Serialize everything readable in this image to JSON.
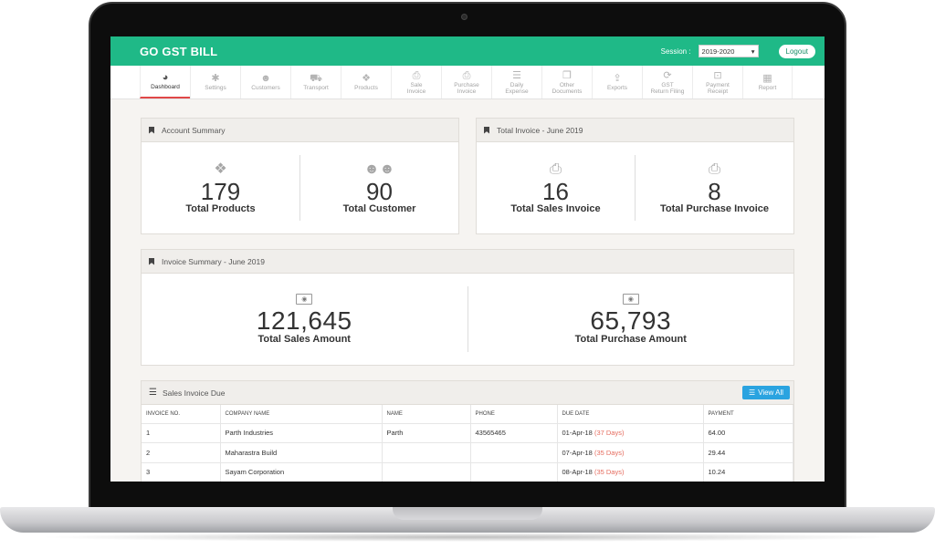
{
  "header": {
    "brand": "GO GST BILL",
    "session_label": "Session :",
    "session_value": "2019-2020",
    "logout_label": "Logout"
  },
  "nav": [
    {
      "label": "Dashboard",
      "icon": "dashboard-icon",
      "glyph": "◕"
    },
    {
      "label": "Settings",
      "icon": "gear-icon",
      "glyph": "✱"
    },
    {
      "label": "Customers",
      "icon": "users-icon",
      "glyph": "☻"
    },
    {
      "label": "Transport",
      "icon": "truck-icon",
      "glyph": "⛟"
    },
    {
      "label": "Products",
      "icon": "cubes-icon",
      "glyph": "❖"
    },
    {
      "label1": "Sale",
      "label2": "Invoice",
      "icon": "printer-icon",
      "glyph": "⎙"
    },
    {
      "label1": "Purchase",
      "label2": "Invoice",
      "icon": "printer-icon",
      "glyph": "⎙"
    },
    {
      "label1": "Daily",
      "label2": "Expense",
      "icon": "list-icon",
      "glyph": "☰"
    },
    {
      "label1": "Other",
      "label2": "Documents",
      "icon": "documents-icon",
      "glyph": "❐"
    },
    {
      "label": "Exports",
      "icon": "upload-icon",
      "glyph": "⇪"
    },
    {
      "label1": "GST",
      "label2": "Return Filing",
      "icon": "refresh-icon",
      "glyph": "⟳"
    },
    {
      "label1": "Payment",
      "label2": "Receipt",
      "icon": "money-icon",
      "glyph": "⊡"
    },
    {
      "label": "Report",
      "icon": "report-icon",
      "glyph": "▦"
    }
  ],
  "account_summary": {
    "title": "Account Summary",
    "products_count": "179",
    "products_label": "Total Products",
    "customers_count": "90",
    "customers_label": "Total Customer"
  },
  "total_invoice": {
    "title": "Total Invoice - June 2019",
    "sales_count": "16",
    "sales_label": "Total Sales Invoice",
    "purchase_count": "8",
    "purchase_label": "Total Purchase Invoice"
  },
  "invoice_summary": {
    "title": "Invoice Summary - June 2019",
    "sales_amount": "121,645",
    "sales_label": "Total Sales Amount",
    "purchase_amount": "65,793",
    "purchase_label": "Total Purchase Amount"
  },
  "sales_due": {
    "title": "Sales Invoice Due",
    "view_all_label": "View All",
    "columns": [
      "INVOICE NO.",
      "COMPANY NAME",
      "NAME",
      "PHONE",
      "DUE DATE",
      "PAYMENT"
    ],
    "rows": [
      {
        "invoice": "1",
        "company": "Parth Industries",
        "name": "Parth",
        "phone": "43565465",
        "due": "01-Apr-18",
        "days": "(37 Days)",
        "payment": "64.00"
      },
      {
        "invoice": "2",
        "company": "Maharastra Build",
        "name": "",
        "phone": "",
        "due": "07-Apr-18",
        "days": "(35 Days)",
        "payment": "29.44"
      },
      {
        "invoice": "3",
        "company": "Sayam Corporation",
        "name": "",
        "phone": "",
        "due": "08-Apr-18",
        "days": "(35 Days)",
        "payment": "10.24"
      }
    ]
  },
  "colors": {
    "brand_green": "#1fb987",
    "active_tab_underline": "#e04848",
    "overdue_red": "#e56b5d",
    "view_all_blue": "#2aa3e0"
  }
}
